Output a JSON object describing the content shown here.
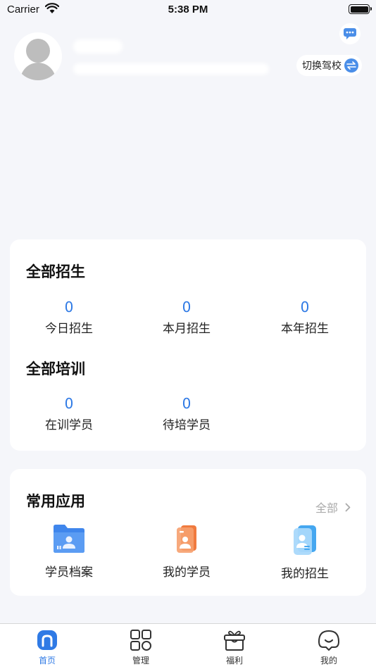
{
  "status_bar": {
    "carrier": "Carrier",
    "time": "5:38 PM"
  },
  "header": {
    "switch_school_label": "切换驾校"
  },
  "stats_card": {
    "enroll_title": "全部招生",
    "enroll_stats": [
      {
        "value": "0",
        "label": "今日招生"
      },
      {
        "value": "0",
        "label": "本月招生"
      },
      {
        "value": "0",
        "label": "本年招生"
      }
    ],
    "training_title": "全部培训",
    "training_stats": [
      {
        "value": "0",
        "label": "在训学员"
      },
      {
        "value": "0",
        "label": "待培学员"
      }
    ]
  },
  "apps_card": {
    "title": "常用应用",
    "all_label": "全部",
    "apps": [
      {
        "label": "学员档案",
        "icon": "student-file-folder-icon"
      },
      {
        "label": "我的学员",
        "icon": "my-student-card-icon"
      },
      {
        "label": "我的招生",
        "icon": "my-enrollment-card-icon"
      }
    ]
  },
  "tabbar": {
    "tabs": [
      {
        "label": "首页",
        "icon": "home-icon",
        "active": true
      },
      {
        "label": "管理",
        "icon": "grid-manage-icon",
        "active": false
      },
      {
        "label": "福利",
        "icon": "gift-icon",
        "active": false
      },
      {
        "label": "我的",
        "icon": "profile-face-icon",
        "active": false
      }
    ]
  },
  "colors": {
    "accent": "#2f7ae5",
    "background": "#f5f6fa",
    "muted": "#aaaaaa"
  }
}
